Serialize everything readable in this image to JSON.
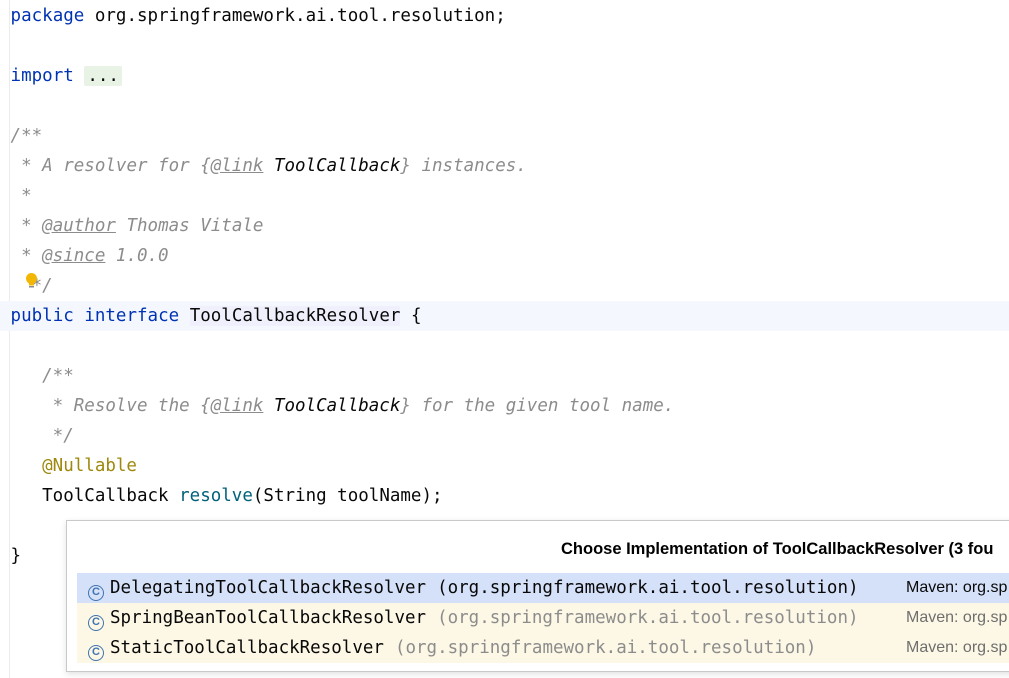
{
  "editor": {
    "package_kw": "package",
    "package_name": " org.springframework.ai.tool.resolution;",
    "import_kw": "import",
    "import_fold": "...",
    "doc_open": "/**",
    "doc_line1_a": " * A resolver for {",
    "doc_line1_tag": "@link",
    "doc_line1_ref": " ToolCallback",
    "doc_line1_b": "} instances.",
    "doc_blank": " *",
    "doc_author_prefix": " * ",
    "doc_author_tag": "@author",
    "doc_author_val": " Thomas Vitale",
    "doc_since_prefix": " * ",
    "doc_since_tag": "@since",
    "doc_since_val": " 1.0.0",
    "doc_close": "*/",
    "iface_public": "public",
    "iface_interface": "interface",
    "iface_name": "ToolCallbackResolver",
    "iface_brace": " {",
    "m_doc_open": "    /**",
    "m_doc_a": "     * Resolve the {",
    "m_doc_tag": "@link",
    "m_doc_ref": " ToolCallback",
    "m_doc_b": "} for the given tool name.",
    "m_doc_close": "     */",
    "annotation": "    @Nullable",
    "m_return": "    ToolCallback ",
    "m_name": "resolve",
    "m_params": "(String toolName);",
    "close_brace": "}"
  },
  "popup": {
    "title": "Choose Implementation of ToolCallbackResolver (3 fou",
    "items": [
      {
        "icon": "C",
        "name": "DelegatingToolCallbackResolver",
        "pkg": "(org.springframework.ai.tool.resolution)",
        "loc": "Maven: org.sp"
      },
      {
        "icon": "C",
        "name": "SpringBeanToolCallbackResolver",
        "pkg": "(org.springframework.ai.tool.resolution)",
        "loc": "Maven: org.sp"
      },
      {
        "icon": "C",
        "name": "StaticToolCallbackResolver",
        "pkg": "(org.springframework.ai.tool.resolution)",
        "loc": "Maven: org.sp"
      }
    ]
  },
  "colors": {
    "keyword": "#0033b3",
    "comment": "#8c8c8c",
    "annotation": "#9e880d",
    "method": "#00627a",
    "selection": "#d5e1f9",
    "popup_list_bg": "#fdf8e5"
  },
  "icons": {
    "bulb": "lightbulb-icon",
    "class": "class-icon"
  }
}
